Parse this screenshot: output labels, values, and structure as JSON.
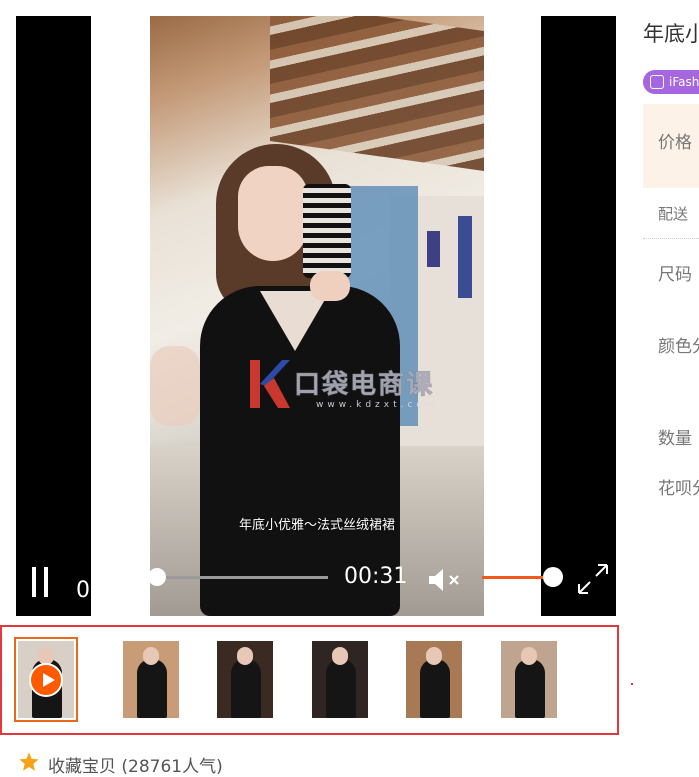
{
  "video": {
    "subtitle": "年底小优雅～法式丝绒裙裙",
    "watermark_text": "口袋电商课",
    "watermark_url": "www.kdzxt.com",
    "time_current": "0",
    "time_total": "00:31",
    "progress_fraction": 0.0,
    "volume_fraction": 1.0
  },
  "thumbnails": [
    {
      "label": "video-thumb",
      "bg": "#d8d0c6",
      "active": true,
      "has_play": true
    },
    {
      "label": "thumb-2",
      "bg": "#c99c78",
      "active": false,
      "has_play": false
    },
    {
      "label": "thumb-3",
      "bg": "#3a2a22",
      "active": false,
      "has_play": false
    },
    {
      "label": "thumb-4",
      "bg": "#2f2522",
      "active": false,
      "has_play": false
    },
    {
      "label": "thumb-5",
      "bg": "#a77a55",
      "active": false,
      "has_play": false
    },
    {
      "label": "thumb-6",
      "bg": "#bfa58f",
      "active": false,
      "has_play": false
    }
  ],
  "favorite": {
    "label": "收藏宝贝",
    "count": "(28761人气)"
  },
  "product": {
    "title": "年底小",
    "brand": "iFashi",
    "price_label": "价格",
    "shipping_label": "配送",
    "size_label": "尺码",
    "color_label": "颜色分",
    "quantity_label": "数量",
    "huabei_label": "花呗分"
  },
  "colors": {
    "accent": "#f25a1b",
    "border_red": "#e4393c",
    "badge_purple": "#a566e0",
    "star": "#f7a21b"
  }
}
